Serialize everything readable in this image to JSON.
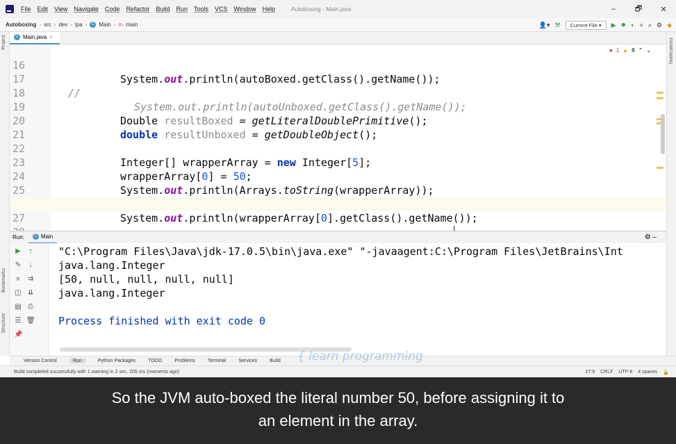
{
  "menubar": {
    "items": [
      "File",
      "Edit",
      "View",
      "Navigate",
      "Code",
      "Refactor",
      "Build",
      "Run",
      "Tools",
      "VCS",
      "Window",
      "Help"
    ],
    "window_title": "Autoboxing - Main.java",
    "minimize": "–",
    "maximize": "🗗",
    "close": "✕"
  },
  "navbar": {
    "project": "Autoboxing",
    "crumbs": [
      "src",
      "dev",
      "lpa",
      "Main",
      "main"
    ],
    "run_config": "Current File ▾"
  },
  "tab": {
    "label": "Main.java",
    "close": "×"
  },
  "side_labels": {
    "project": "Project",
    "bookmarks": "Bookmarks",
    "structure": "Structure",
    "notifications": "Notifications"
  },
  "inspections": {
    "errors": "1",
    "warnings": "8"
  },
  "editor_lines": [
    {
      "n": "16",
      "text": "System.out.println(autoBoxed.getClass().getName());"
    },
    {
      "n": "17",
      "prefix": "//",
      "text": "System.out.println(autoUnboxed.getClass().getName());"
    },
    {
      "n": "18",
      "text": ""
    },
    {
      "n": "19",
      "type": "Double",
      "var": "resultBoxed",
      "eq": " = ",
      "call": "getLiteralDoublePrimitive",
      "end": "();"
    },
    {
      "n": "20",
      "type": "double",
      "var": "resultUnboxed",
      "eq": " = ",
      "call": "getDoubleObject",
      "end": "();"
    },
    {
      "n": "21",
      "text": ""
    },
    {
      "n": "22",
      "a": "Integer[] wrapperArray = ",
      "kw": "new",
      "b": " Integer[",
      "num": "5",
      "c": "];"
    },
    {
      "n": "23",
      "a": "wrapperArray[",
      "num": "0",
      "b": "] = ",
      "num2": "50",
      "c": ";"
    },
    {
      "n": "24",
      "a": "System.",
      "fld": "out",
      "b": ".println(Arrays.",
      "mth": "toString",
      "c": "(wrapperArray));"
    },
    {
      "n": "25",
      "text": ""
    },
    {
      "n": "26",
      "a": "System.",
      "fld": "out",
      "b": ".println(wrapperArray[",
      "num": "0",
      "c": "].getClass().getName());"
    },
    {
      "n": "27",
      "text": ""
    },
    {
      "n": "28",
      "text": "}"
    }
  ],
  "run": {
    "label": "Run:",
    "tab": "Main",
    "console": [
      "\"C:\\Program Files\\Java\\jdk-17.0.5\\bin\\java.exe\" \"-javaagent:C:\\Program Files\\JetBrains\\Int",
      "java.lang.Integer",
      "[50, null, null, null, null]",
      "java.lang.Integer",
      "",
      "Process finished with exit code 0"
    ]
  },
  "toolwindows": [
    "Version Control",
    "Run",
    "Python Packages",
    "TODO",
    "Problems",
    "Terminal",
    "Services",
    "Build"
  ],
  "status": {
    "message": "Build completed successfully with 1 warning in 2 sec, 205 ms (moments ago)",
    "position": "27:9",
    "line_sep": "CRLF",
    "encoding": "UTF-8",
    "indent": "4 spaces"
  },
  "watermark": "{ learn programming",
  "caption": [
    "So the JVM auto-boxed the literal number 50, before assigning it to",
    "an element in the array."
  ]
}
